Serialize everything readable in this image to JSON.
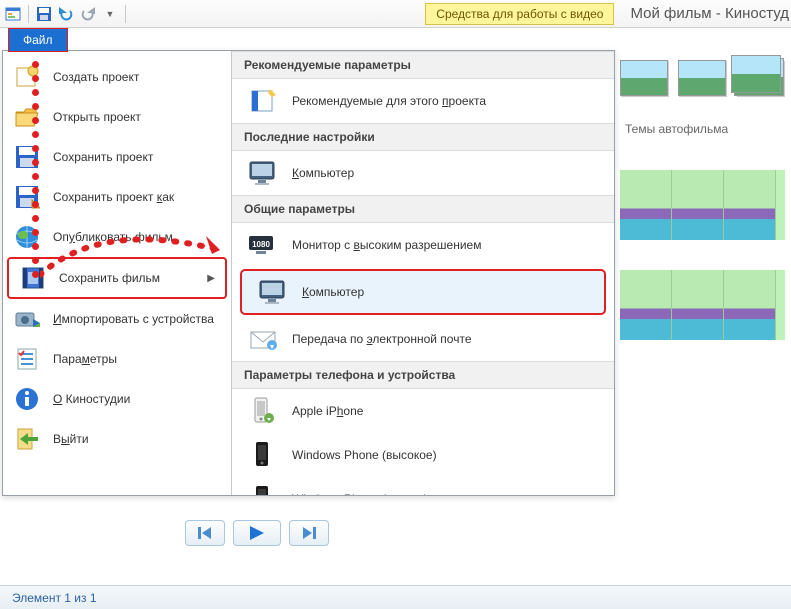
{
  "titlebar": {
    "context_tab": "Средства для работы с видео",
    "document_title": "Мой фильм - Киностуд"
  },
  "file_tab": "Файл",
  "menu_left": [
    {
      "id": "new-project",
      "label": "Создать проект"
    },
    {
      "id": "open-project",
      "label": "Открыть проект"
    },
    {
      "id": "save-project",
      "label": "Сохранить проект"
    },
    {
      "id": "save-project-as",
      "label_pre": "Сохранить проект ",
      "accel": "к",
      "label_post": "ак"
    },
    {
      "id": "publish-movie",
      "label_pre": "Оп",
      "accel": "у",
      "label_post": "бликовать фильм"
    },
    {
      "id": "save-movie",
      "label": "Сохранить фильм",
      "arrow": true,
      "highlight": true
    },
    {
      "id": "import-device",
      "label_pre": "",
      "accel": "И",
      "label_post": "мпортировать с устройства"
    },
    {
      "id": "options",
      "label_pre": "Пара",
      "accel": "м",
      "label_post": "етры"
    },
    {
      "id": "about",
      "label_pre": "",
      "accel": "О",
      "label_post": " Киностудии"
    },
    {
      "id": "exit",
      "label_pre": "В",
      "accel": "ы",
      "label_post": "йти"
    }
  ],
  "menu_right": {
    "sections": [
      {
        "title": "Рекомендуемые параметры",
        "items": [
          {
            "id": "recommended-project",
            "label_pre": "Рекомендуемые для этого ",
            "accel": "п",
            "label_post": "роекта",
            "icon": "wizard"
          }
        ]
      },
      {
        "title": "Последние настройки",
        "items": [
          {
            "id": "recent-computer",
            "label_pre": "",
            "accel": "К",
            "label_post": "омпьютер",
            "icon": "monitor"
          }
        ]
      },
      {
        "title": "Общие параметры",
        "items": [
          {
            "id": "hd-monitor",
            "label_pre": "Монитор с ",
            "accel": "в",
            "label_post": "ысоким разрешением",
            "icon": "hd"
          },
          {
            "id": "computer",
            "label_pre": "",
            "accel": "К",
            "label_post": "омпьютер",
            "icon": "monitor",
            "highlight": true
          },
          {
            "id": "email",
            "label_pre": "Передача по ",
            "accel": "э",
            "label_post": "лектронной почте",
            "icon": "mail"
          }
        ]
      },
      {
        "title": "Параметры телефона и устройства",
        "items": [
          {
            "id": "iphone",
            "label_pre": "Apple iP",
            "accel": "h",
            "label_post": "one",
            "icon": "phone-white"
          },
          {
            "id": "wp-high",
            "label": "Windows Phone (высокое)",
            "icon": "phone-dark"
          },
          {
            "id": "wp-low",
            "label_pre": "Windows Phone (",
            "accel": "н",
            "label_post": "изкое)",
            "icon": "phone-dark"
          }
        ]
      }
    ]
  },
  "themes_label": "Темы автофильма",
  "statusbar": {
    "text": "Элемент 1 из 1"
  }
}
